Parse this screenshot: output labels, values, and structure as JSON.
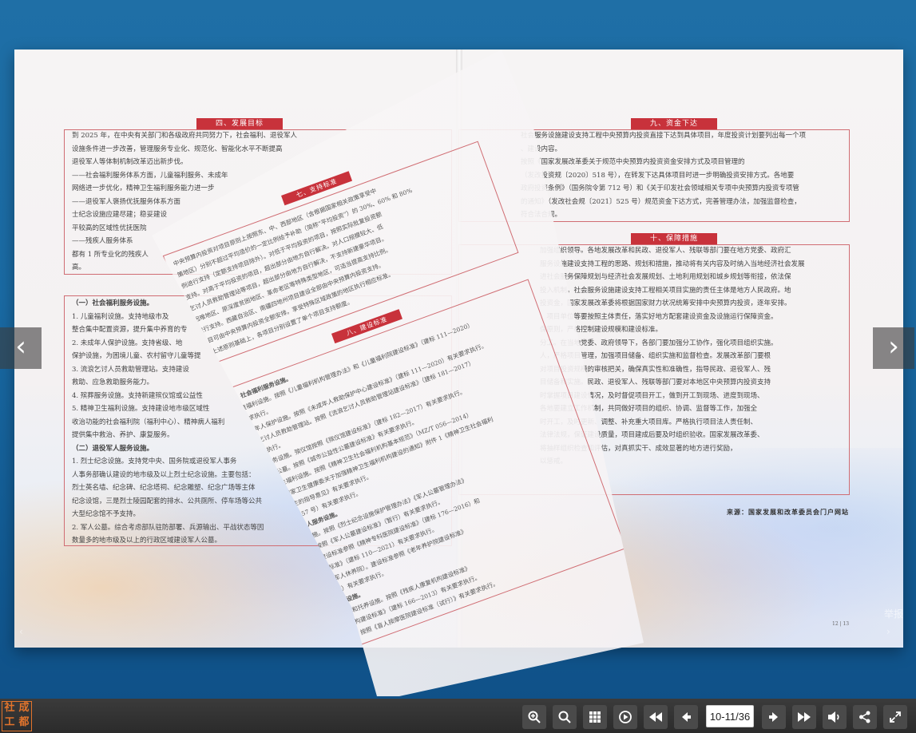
{
  "left_page": {
    "section_title": "四、发展目标",
    "intro_lines": [
      "到 2025 年，在中央有关部门和各级政府共同努力下，社会福利、退役军人",
      "设施条件进一步改善，管理服务专业化、规范化、智能化水平不断提高",
      "退役军人等体制机制改革迈出新步伐。",
      "——社会福利服务体系方面，儿童福利服务、未成年",
      "网络进一步优化，精神卫生福利服务能力进一步",
      "——退役军人褒扬优抚服务体系方面",
      "士纪念设施应建尽建；稳妥建设",
      "平较高的区域性优抚医院",
      "——残疾人服务体系",
      "都有 1 所专业化的残疾人",
      "高。"
    ],
    "list_lines": [
      "（一）社会福利服务设施。",
      "1. 儿童福利设施。支持地级市及",
      "整合集中配置资源，提升集中养育的专",
      "2. 未成年人保护设施。支持省级、地",
      "保护设施，为困境儿童、农村留守儿童等提",
      "3. 流浪乞讨人员救助管理站。支持建设",
      "救助、应急救助服务能力。",
      "4. 殡葬服务设施。支持新建殡仪馆或公益性",
      "5. 精神卫生福利设施。支持建设地市级区域性",
      "收治功能的社会福利院（福利中心）、精神病人福利",
      "提供集中救治、养护、康复服务。",
      "（二）退役军人服务设施。",
      "1. 烈士纪念设施。支持党中央、国务院或退役军人事务",
      "人事务部确认建设的地市级及以上烈士纪念设施。主要包括：",
      "烈士英名墙、纪念碑、纪念塔祠、纪念雕塑、纪念广场等主体",
      "纪念设馆，三是烈士陵园配套的排水、公共厕所、停车场等公共",
      "大型纪念馆不予支持。",
      "2. 军人公墓。综合考虑部队驻防部署、兵源输出、平战状态等因",
      "数量多的地市级及以上的行政区域建设军人公墓。"
    ]
  },
  "right_page": {
    "section9_title": "九、资金下达",
    "section9_lines": [
      "社会服务设施建设支持工程中央预算内投资直接下达到具体项目，年度投资计划要列出每一个项",
      "、建设内容。",
      "按照《国家发展改革委关于规范中央预算内投资资金安排方式及项目管理的",
      "（发改投资规〔2020〕518 号），在转发下达具体项目时进一步明确投资安排方式。各地要",
      "政府投资条例》（国务院令第 712 号）和《关于印发社会领域相关专项中央预算内投资专项管",
      "的通知》（发改社会规〔2021〕525 号）规范资金下达方式，完善管理办法，加强监督检查，",
      "符合法合规。"
    ],
    "section10_title": "十、保障措施",
    "section10_lines": [
      "加强组织领导。各地发展改革和民政、退役军人、残联等部门要在地方党委、政府汇",
      "服务设施建设支持工程的思路、规划和措施，推动将有关内容及时纳入当地经济社会发展",
      "进社会服务保障规划与经济社会发展规划、土地利用规划和城乡规划等衔接，依法保",
      "投入机制。社会服务设施建设支持工程相关项目实施的责任主体是地方人民政府。地",
      "投资金，国家发展改革委将根据国家财力状况统筹安排中央预算内投资，逐年安排。",
      "，项目单位等要按照主体责任，落实好地方配套建设资金及设施运行保障资金。",
      "保原则，严格控制建设规模和建设标准。",
      "分工。在当地党委、政府领导下，各部门要加强分工协作，强化项目组织实施。",
      "人，严格项目管理，加强项目储备、组织实施和监督检查。发展改革部门要根",
      "对项目投资规模的审核把关，确保真实性和准确性，指导民政、退役军人、残",
      "目储备和实施。民政、退役军人、残联等部门要对本地区中央预算内投资支持",
      "时掌握项目建设情况，及时督促项目开工，做到开工到现场、进度到现场、",
      "各地要建立工作机制，共同做好项目的组织、协调、监督等工作，加强全",
      "时开工，及时更新、调整、补充重大项目库。严格执行项目法人责任制、",
      "法律法规，保证建设质量，项目建成后要及时组织验收。国家发展改革委、",
      "将抽样组织检查和评估，对真抓实干、成效显著的地方进行奖励，",
      "以惩戒。"
    ],
    "source": "来源：国家发展和改革委员会门户网站",
    "page_numbers": "12 | 13"
  },
  "flip_page": {
    "section7_title": "七、支持标准",
    "section7_lines": [
      "中央预算内投资对项目原则上按照东、中、西部地区（含根据国家相关政策享受中",
      "策地区）分别不超过平均造价的一定比例给予补助（简称“平均投资”）的 30%、60% 和 80%",
      "例进行支持（定额支持项目除外）。对低于平均投资的项目，按照实际批复投资额",
      "支持。对高于平均投资的项目，超出部分由地方自行解决。对人口规模较大、低",
      "乞讨人员救助管理站等项目，超出部分由地方自行解决，不支持新建豪华项目。",
      "困难地区、原深度贫困地区、革命老区等特殊类型地区，可适当提高支持比例。",
      "进行支持。西藏自治区、南疆四地州项目建设全部由中央预算内投资支持。",
      "项目可由中央预算内投资全额安排。享受特殊区域政策的地区执行相应标准。",
      "在上述原则基础上，各项目分别设置了单个项目支持额度。"
    ],
    "section8_title": "八、建设标准",
    "section8_lines": [
      "（一）社会福利服务设施。",
      "1. 儿童福利设施。按照《儿童福利机构管理办法》和《儿童福利院建设标准》（建标 111—2020）",
      "有关要求执行。",
      "2. 未成年人保护设施。按照《未成年人救助保护中心建设标准》（建标 111—2020）有关要求执行。",
      "3. 流浪乞讨人员救助管理站。按照《流浪乞讨人员救助管理站建设标准》（建标 181—2017）",
      "有关要求执行。",
      "4. 殡葬服务设施。殡仪馆按照《殡仪馆建设标准》（建标 182—2017）有关要求执行。",
      "5. 公益性公墓。按照《城市公益性公墓建设标准》有关要求执行。",
      "6. 精神卫生福利设施。按照《精神卫生社会福利机构基本规范》（MZ/T 056—2014）",
      "《民政部 国家卫生健康委关于加强精神卫生福利机构建设的通知》附件 1《精神卫生社会福利",
      "发展精神卫生的指导意见》有关要求执行。",
      "（2010）2257 号）有关要求执行。",
      "（二）退役军人服务设施。",
      "1. 烈士纪念设施。按照《烈士纪念设施保护管理办法》《军人公墓管理办法》",
      "2. 军人公墓。按照《军人公墓建设标准》（暂行）有关要求执行。",
      "3. 优抚医院。建设标准参照《精神专科医院建设标准》（建标 176—2016）和",
      "《综合医院建设标准》（建标 110—2021）有关要求执行。",
      "4. 光荣院（荣誉军人休养院）。建设标准参照《老年养护院建设标准》",
      "标准（2012 年版）有关要求执行。",
      "（三）残疾人服务设施。",
      "1. 残疾人康复设施和托养设施。按照《残疾人康复机构建设标准》",
      "和《残疾人托养机构建设标准》（建标 166—2013）有关要求执行。",
      "2. 盲人按摩医院。按照《盲人按摩医院建设标准（试行）》有关要求执行。"
    ]
  },
  "navigation": {
    "prev_arrow": "‹",
    "next_arrow": "›",
    "watermark": "举报",
    "corner_left": "‹",
    "corner_right": "›"
  },
  "toolbar": {
    "logo_chars": [
      "成",
      "社",
      "都",
      "工"
    ],
    "page_indicator": "10-11/36",
    "buttons": [
      {
        "name": "zoom-in-button",
        "icon": "zoom-in-icon"
      },
      {
        "name": "search-button",
        "icon": "search-icon"
      },
      {
        "name": "thumbnails-button",
        "icon": "grid-icon"
      },
      {
        "name": "autoplay-button",
        "icon": "play-icon"
      },
      {
        "name": "first-page-button",
        "icon": "first-page-icon"
      },
      {
        "name": "prev-page-button",
        "icon": "prev-page-icon"
      },
      {
        "name": "next-page-button",
        "icon": "next-page-icon"
      },
      {
        "name": "last-page-button",
        "icon": "last-page-icon"
      },
      {
        "name": "sound-button",
        "icon": "volume-icon"
      },
      {
        "name": "share-button",
        "icon": "share-icon"
      },
      {
        "name": "fullscreen-button",
        "icon": "fullscreen-icon"
      }
    ]
  },
  "colors": {
    "accent_red": "#c8323b",
    "logo_orange": "#e2742c",
    "background_blue": "#1a6aa3"
  }
}
